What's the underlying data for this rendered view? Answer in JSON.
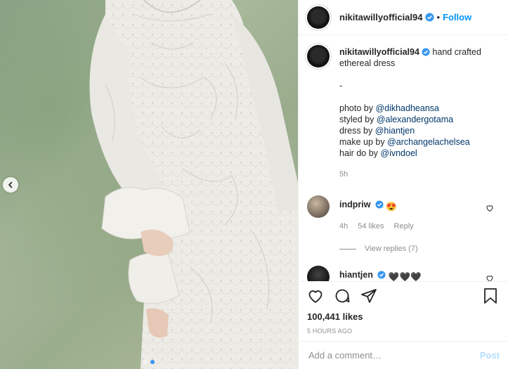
{
  "post": {
    "username": "nikitawillyofficial94",
    "follow_label": "Follow",
    "separator": "•",
    "caption_first": "hand crafted",
    "caption_second": "ethereal dress",
    "caption_dash": "-",
    "credits": [
      {
        "prefix": "photo by ",
        "mention": "@dikhadheansa"
      },
      {
        "prefix": "styled by ",
        "mention": "@alexandergotama"
      },
      {
        "prefix": "dress by ",
        "mention": "@hiantjen"
      },
      {
        "prefix": "make up by ",
        "mention": "@archangelachelsea"
      },
      {
        "prefix": "hair do by ",
        "mention": "@ivndoel"
      }
    ],
    "caption_time": "5h",
    "likes": "100,441 likes",
    "posted_ago": "5 HOURS AGO",
    "carousel_dots": 2,
    "carousel_active_dot": 2
  },
  "comments": [
    {
      "username": "indpriw",
      "text": "😍",
      "time": "4h",
      "likes": "54 likes",
      "reply_label": "Reply"
    },
    {
      "username": "hiantjen",
      "text": "🖤🖤🖤"
    }
  ],
  "view_replies": "View replies (7)",
  "add_comment": {
    "placeholder": "Add a comment…",
    "post_label": "Post"
  },
  "icons": {
    "carousel_prev": "chevron-left-icon",
    "like": "heart-icon",
    "comment": "comment-bubble-icon",
    "share": "paper-plane-icon",
    "save": "bookmark-icon",
    "verified": "verified-badge-icon"
  },
  "colors": {
    "link": "#0095f6",
    "mention": "#00376b",
    "muted": "#8e8e8e",
    "post_disabled": "#b2dffc"
  }
}
